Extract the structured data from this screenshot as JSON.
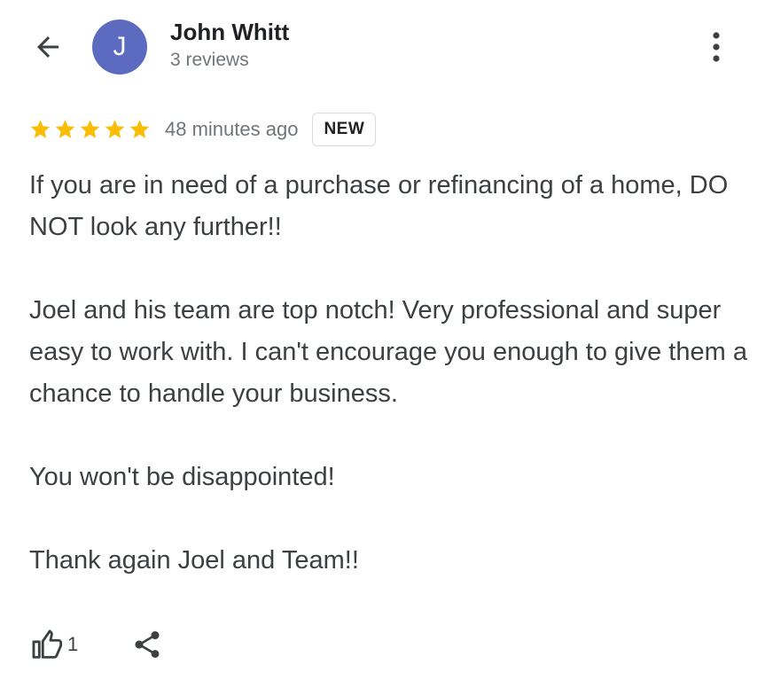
{
  "header": {
    "back_icon": "arrow-back-icon",
    "author": {
      "avatar_initial": "J",
      "avatar_color": "#5c6bc0",
      "name": "John Whitt",
      "reviews_count": "3 reviews"
    },
    "more_icon": "more-vertical-icon"
  },
  "review": {
    "rating": 5,
    "rating_max": 5,
    "star_color": "#fbbc04",
    "time_ago": "48 minutes ago",
    "badge": "NEW",
    "paragraphs": [
      "If you are in need of a purchase or refinancing of a home, DO NOT look any further!!",
      "Joel and his team are top notch! Very professional and super easy to work with. I can't encourage you enough to give them a chance to handle your business.",
      "You won't be disappointed!",
      "Thank again Joel and Team!!"
    ]
  },
  "actions": {
    "like_icon": "thumbs-up-icon",
    "like_count": "1",
    "share_icon": "share-icon"
  }
}
